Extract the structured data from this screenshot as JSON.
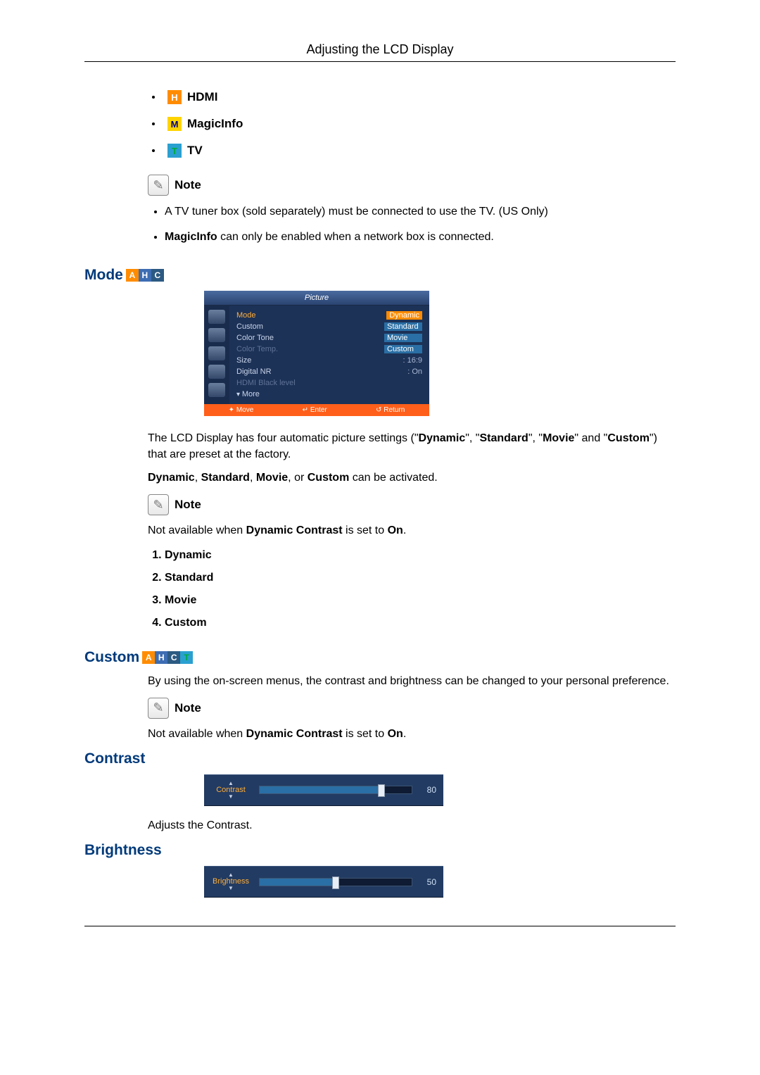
{
  "header": {
    "title": "Adjusting the LCD Display"
  },
  "inputs": {
    "hdmi": {
      "label": "HDMI",
      "icon": "H"
    },
    "magicinfo": {
      "label": "MagicInfo",
      "icon": "M"
    },
    "tv": {
      "label": "TV",
      "icon": "T"
    }
  },
  "note_label": "Note",
  "notes_top": {
    "tv_tuner": "A TV tuner box (sold separately) must be connected to use the TV. (US Only)",
    "magicinfo_prefix": "MagicInfo",
    "magicinfo_rest": " can only be enabled when a network box is connected."
  },
  "mode_section": {
    "title": "Mode",
    "osd": {
      "header": "Picture",
      "rows": {
        "mode": {
          "label": "Mode",
          "value": "Dynamic"
        },
        "custom": {
          "label": "Custom",
          "value": "Standard"
        },
        "color_tone": {
          "label": "Color Tone",
          "value": "Movie"
        },
        "color_temp": {
          "label": "Color Temp.",
          "value": "Custom"
        },
        "size": {
          "label": "Size",
          "value": ": 16:9"
        },
        "digital_nr": {
          "label": "Digital NR",
          "value": ": On"
        },
        "hdmi_black": {
          "label": "HDMI Black level",
          "value": ""
        },
        "more": {
          "label": "More"
        }
      },
      "footer": {
        "move": "Move",
        "enter": "Enter",
        "return": "Return"
      }
    },
    "intro_pre": "The LCD Display has four automatic picture settings (\"",
    "intro_dynamic": "Dynamic",
    "intro_sep1": "\", \"",
    "intro_standard": "Standard",
    "intro_sep2": "\", \"",
    "intro_movie": "Movie",
    "intro_sep3": "\" and \"",
    "intro_custom": "Custom",
    "intro_post": "\") that are preset at the factory.",
    "activate_pre": "",
    "activate_dynamic": "Dynamic",
    "activate_c1": ", ",
    "activate_standard": "Standard",
    "activate_c2": ", ",
    "activate_movie": "Movie",
    "activate_c3": ", or ",
    "activate_custom": "Custom",
    "activate_post": " can be activated.",
    "note_body_pre": "Not available when ",
    "note_body_bold": "Dynamic Contrast",
    "note_body_mid": " is set to ",
    "note_body_on": "On",
    "note_body_end": ".",
    "list": {
      "i1": "Dynamic",
      "i2": "Standard",
      "i3": "Movie",
      "i4": "Custom"
    }
  },
  "custom_section": {
    "title": "Custom",
    "body": "By using the on-screen menus, the contrast and brightness can be changed to your personal preference.",
    "note_body_pre": "Not available when ",
    "note_body_bold": "Dynamic Contrast",
    "note_body_mid": " is set to ",
    "note_body_on": "On",
    "note_body_end": "."
  },
  "contrast_section": {
    "title": "Contrast",
    "slider": {
      "label": "Contrast",
      "value": "80",
      "percent": 80
    },
    "body": "Adjusts the Contrast."
  },
  "brightness_section": {
    "title": "Brightness",
    "slider": {
      "label": "Brightness",
      "value": "50",
      "percent": 50
    }
  }
}
